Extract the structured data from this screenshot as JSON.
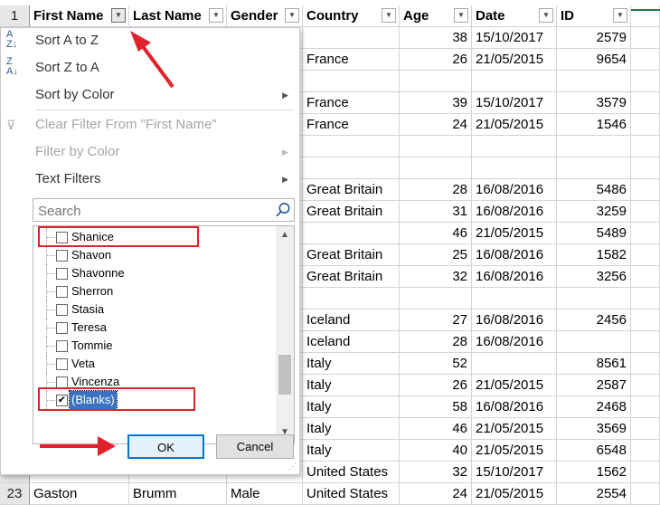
{
  "columns": [
    {
      "label": "First Name",
      "filter_active": true
    },
    {
      "label": "Last Name"
    },
    {
      "label": "Gender"
    },
    {
      "label": "Country"
    },
    {
      "label": "Age"
    },
    {
      "label": "Date"
    },
    {
      "label": "ID"
    }
  ],
  "header_row_number": "1",
  "rows": [
    {
      "country": "",
      "age": "38",
      "date": "15/10/2017",
      "id": "2579"
    },
    {
      "country": "France",
      "age": "26",
      "date": "21/05/2015",
      "id": "9654"
    },
    {
      "country": "",
      "age": "",
      "date": "",
      "id": ""
    },
    {
      "country": "France",
      "age": "39",
      "date": "15/10/2017",
      "id": "3579"
    },
    {
      "country": "France",
      "age": "24",
      "date": "21/05/2015",
      "id": "1546"
    },
    {
      "country": "",
      "age": "",
      "date": "",
      "id": ""
    },
    {
      "country": "",
      "age": "",
      "date": "",
      "id": ""
    },
    {
      "country": "Great Britain",
      "age": "28",
      "date": "16/08/2016",
      "id": "5486"
    },
    {
      "country": "Great Britain",
      "age": "31",
      "date": "16/08/2016",
      "id": "3259"
    },
    {
      "country": "",
      "age": "46",
      "date": "21/05/2015",
      "id": "5489"
    },
    {
      "country": "Great Britain",
      "age": "25",
      "date": "16/08/2016",
      "id": "1582"
    },
    {
      "country": "Great Britain",
      "age": "32",
      "date": "16/08/2016",
      "id": "3256"
    },
    {
      "country": "",
      "age": "",
      "date": "",
      "id": ""
    },
    {
      "country": "Iceland",
      "age": "27",
      "date": "16/08/2016",
      "id": "2456"
    },
    {
      "country": "Iceland",
      "age": "28",
      "date": "16/08/2016",
      "id": ""
    },
    {
      "country": "Italy",
      "age": "52",
      "date": "",
      "id": "8561"
    },
    {
      "country": "Italy",
      "age": "26",
      "date": "21/05/2015",
      "id": "2587"
    },
    {
      "country": "Italy",
      "age": "58",
      "date": "16/08/2016",
      "id": "2468"
    },
    {
      "country": "Italy",
      "age": "46",
      "date": "21/05/2015",
      "id": "3569"
    },
    {
      "country": "Italy",
      "age": "40",
      "date": "21/05/2015",
      "id": "6548"
    },
    {
      "country": "United States",
      "age": "32",
      "date": "15/10/2017",
      "id": "1562"
    },
    {
      "rownum": "23",
      "first": "Gaston",
      "last": "Brumm",
      "gender": "Male",
      "country": "United States",
      "age": "24",
      "date": "21/05/2015",
      "id": "2554"
    }
  ],
  "menu": {
    "sort_az": "Sort A to Z",
    "sort_za": "Sort Z to A",
    "sort_color": "Sort by Color",
    "clear_filter": "Clear Filter From \"First Name\"",
    "filter_color": "Filter by Color",
    "text_filters": "Text Filters",
    "search_placeholder": "Search",
    "list": [
      {
        "label": "Shanice",
        "checked": false
      },
      {
        "label": "Shavon",
        "checked": false
      },
      {
        "label": "Shavonne",
        "checked": false
      },
      {
        "label": "Sherron",
        "checked": false
      },
      {
        "label": "Stasia",
        "checked": false
      },
      {
        "label": "Teresa",
        "checked": false
      },
      {
        "label": "Tommie",
        "checked": false
      },
      {
        "label": "Veta",
        "checked": false
      },
      {
        "label": "Vincenza",
        "checked": false
      },
      {
        "label": "(Blanks)",
        "checked": true
      }
    ],
    "ok": "OK",
    "cancel": "Cancel"
  },
  "colors": {
    "highlight_box": "#e2222a",
    "ok_border": "#0078d7",
    "selection": "#3a73c2",
    "excel_green": "#217346"
  }
}
